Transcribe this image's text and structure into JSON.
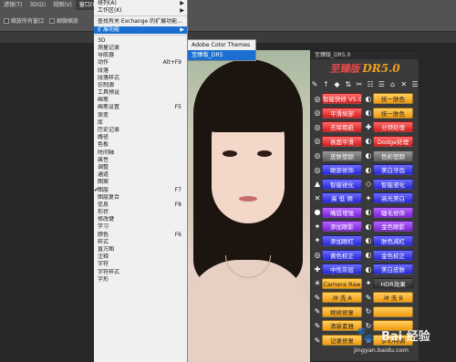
{
  "menubar": [
    "滤镜(T)",
    "3D(D)",
    "视图(V)",
    "窗口(W)"
  ],
  "options": {
    "opt1": "缩放所有窗口",
    "opt2": "细微缩放"
  },
  "window_menu": [
    {
      "label": "排列(A)",
      "arrow": "▶",
      "shortcut": ""
    },
    {
      "label": "工作区(K)",
      "arrow": "▶",
      "shortcut": ""
    },
    {
      "sep": true
    },
    {
      "label": "查找有关 Exchange 的扩展功能...",
      "arrow": "",
      "shortcut": ""
    },
    {
      "label": "扩展功能",
      "arrow": "▶",
      "shortcut": "",
      "hl": true
    },
    {
      "sep": true
    },
    {
      "label": "3D",
      "shortcut": ""
    },
    {
      "label": "测量记录",
      "shortcut": ""
    },
    {
      "label": "导航器",
      "shortcut": ""
    },
    {
      "label": "动作",
      "shortcut": "Alt+F9"
    },
    {
      "label": "段落",
      "shortcut": ""
    },
    {
      "label": "段落样式",
      "shortcut": ""
    },
    {
      "label": "仿制源",
      "shortcut": ""
    },
    {
      "label": "工具预设",
      "shortcut": ""
    },
    {
      "label": "画笔",
      "shortcut": ""
    },
    {
      "label": "画笔设置",
      "shortcut": "F5"
    },
    {
      "label": "渐变",
      "shortcut": ""
    },
    {
      "label": "库",
      "shortcut": ""
    },
    {
      "label": "历史记录",
      "shortcut": ""
    },
    {
      "label": "路径",
      "shortcut": ""
    },
    {
      "label": "色板",
      "shortcut": ""
    },
    {
      "label": "时间轴",
      "shortcut": ""
    },
    {
      "label": "属性",
      "shortcut": ""
    },
    {
      "label": "调整",
      "shortcut": ""
    },
    {
      "label": "通道",
      "shortcut": ""
    },
    {
      "label": "图案",
      "shortcut": ""
    },
    {
      "label": "图层",
      "shortcut": "F7",
      "check": "✔"
    },
    {
      "label": "图层复合",
      "shortcut": ""
    },
    {
      "label": "信息",
      "shortcut": "F8"
    },
    {
      "label": "形状",
      "shortcut": ""
    },
    {
      "label": "修改键",
      "shortcut": ""
    },
    {
      "label": "学习",
      "shortcut": ""
    },
    {
      "label": "颜色",
      "shortcut": "F6"
    },
    {
      "label": "样式",
      "shortcut": ""
    },
    {
      "label": "直方图",
      "shortcut": ""
    },
    {
      "label": "注释",
      "shortcut": ""
    },
    {
      "label": "字符",
      "shortcut": ""
    },
    {
      "label": "字符样式",
      "shortcut": ""
    },
    {
      "label": "字形",
      "shortcut": ""
    }
  ],
  "submenu": [
    {
      "label": "Adobe Color Themes",
      "hl": false
    },
    {
      "label": "至臻版_DR5",
      "hl": true
    }
  ],
  "panel": {
    "title": "至臻版_DR5.0",
    "brand1": "至臻版",
    "brand2": "DR5.0",
    "toolbar_icons": [
      "✎",
      "↑",
      "◆",
      "⇅",
      "✂",
      "☷",
      "☰",
      "⌂",
      "✕",
      "☰"
    ],
    "rows": [
      [
        {
          "ic": "◎",
          "label": "智能快修 V5.0",
          "color": "red"
        },
        {
          "ic": "◐",
          "label": "统一肤色",
          "color": "orange"
        }
      ],
      [
        {
          "ic": "◎",
          "label": "平滑局部",
          "color": "red"
        },
        {
          "ic": "◐",
          "label": "统一肤色",
          "color": "orange"
        }
      ],
      [
        {
          "ic": "◎",
          "label": "去除瑕疵",
          "color": "red"
        },
        {
          "ic": "✚",
          "label": "分频处理",
          "color": "red"
        }
      ],
      [
        {
          "ic": "◎",
          "label": "表面平滑",
          "color": "red"
        },
        {
          "ic": "◐",
          "label": "Dodge处理",
          "color": "red"
        }
      ],
      [
        {
          "ic": "◎",
          "label": "皮肤塑颜",
          "color": "gray"
        },
        {
          "ic": "◐",
          "label": "色彩塑颜",
          "color": "gray"
        }
      ],
      [
        {
          "ic": "◎",
          "label": "眼部修饰",
          "color": "blue"
        },
        {
          "ic": "◐",
          "label": "美白牙齿",
          "color": "blue"
        }
      ],
      [
        {
          "ic": "▲",
          "label": "智能锐化",
          "color": "blue"
        },
        {
          "ic": "◇",
          "label": "智能液化",
          "color": "blue"
        }
      ],
      [
        {
          "ic": "✕",
          "label": "高 低 频",
          "color": "blue"
        },
        {
          "ic": "✦",
          "label": "高光美白",
          "color": "blue"
        }
      ],
      [
        {
          "ic": "●",
          "label": "嘴唇增强",
          "color": "purple"
        },
        {
          "ic": "◐",
          "label": "睫毛修饰",
          "color": "purple"
        }
      ],
      [
        {
          "ic": "✦",
          "label": "添加眼影",
          "color": "purple"
        },
        {
          "ic": "◐",
          "label": "金色眼影",
          "color": "purple"
        }
      ],
      [
        {
          "ic": "✦",
          "label": "添加眼红",
          "color": "blue"
        },
        {
          "ic": "◐",
          "label": "肤色减红",
          "color": "blue"
        }
      ],
      [
        {
          "ic": "◎",
          "label": "黄色校正",
          "color": "blue"
        },
        {
          "ic": "◐",
          "label": "金色校正",
          "color": "blue"
        }
      ],
      [
        {
          "ic": "✚",
          "label": "中性灰层",
          "color": "blue"
        },
        {
          "ic": "◐",
          "label": "美白皮肤",
          "color": "blue"
        }
      ],
      [
        {
          "ic": "☀",
          "label": "Camera Raw",
          "color": "orange"
        },
        {
          "ic": "✦",
          "label": "HDR效果",
          "color": "dark"
        }
      ],
      [
        {
          "ic": "✎",
          "label": "冲 洗 A",
          "color": "orange"
        },
        {
          "ic": "✎",
          "label": "冲 洗 B",
          "color": "orange"
        }
      ],
      [
        {
          "ic": "✎",
          "label": "继续修复",
          "color": "orange"
        },
        {
          "ic": "↻",
          "label": "",
          "color": "orange"
        }
      ],
      [
        {
          "ic": "✎",
          "label": "清新素雅",
          "color": "orange"
        },
        {
          "ic": "↻",
          "label": "",
          "color": "orange"
        }
      ],
      [
        {
          "ic": "✎",
          "label": "记录修复",
          "color": "orange"
        },
        {
          "ic": "★",
          "label": "梦幻特调",
          "color": "orange"
        }
      ]
    ]
  },
  "watermark": {
    "main": "Bai 经验",
    "sub": "jingyan.baidu.com",
    "paw": "🐾"
  }
}
